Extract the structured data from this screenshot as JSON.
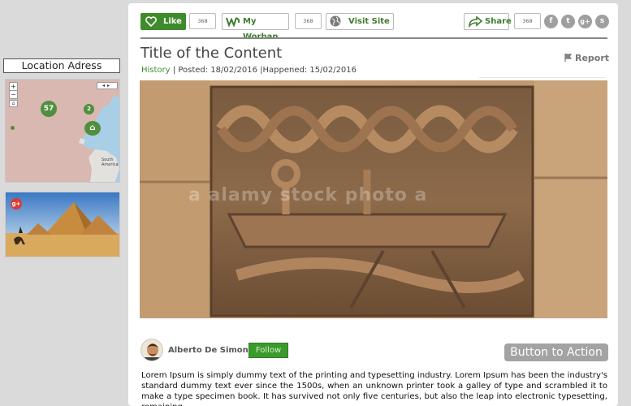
{
  "sidebar": {
    "location_label": "Location Adress",
    "map": {
      "clusters": [
        {
          "label": "57"
        },
        {
          "label": "2"
        }
      ],
      "labels": {
        "south_america": "South America"
      },
      "zoom_in": "+",
      "zoom_out": "−"
    },
    "photo_badge": "g+"
  },
  "toolbar": {
    "like_label": "Like",
    "like_count": "368",
    "worban_label": "My Worban",
    "worban_count": "368",
    "visit_label": "Visit Site",
    "share_label": "Share",
    "share_count": "368",
    "social": [
      "f",
      "t",
      "g+",
      "s"
    ]
  },
  "content": {
    "title": "Title of the Content",
    "report_label": "Report",
    "category": "History",
    "posted": "Posted: 18/02/2016",
    "happened": "Happened: 15/02/2016",
    "watermark": "a alamy stock photo a"
  },
  "author": {
    "name": "Alberto De Simone",
    "follow_label": "Follow",
    "cta_label": "Button to Action"
  },
  "body_text": "Lorem Ipsum is simply dummy text of the printing and typesetting industry. Lorem Ipsum has been the industry's standard dummy text ever since the 1500s, when an unknown printer took a galley of type and scrambled it to make a type specimen book. It has survived not only five centuries, but also the leap into electronic typesetting, remaining",
  "colors": {
    "brand_green": "#3e7c2c",
    "follow_green": "#3b9a2c",
    "cta_gray": "#a3a3a3",
    "background": "#dadada"
  }
}
